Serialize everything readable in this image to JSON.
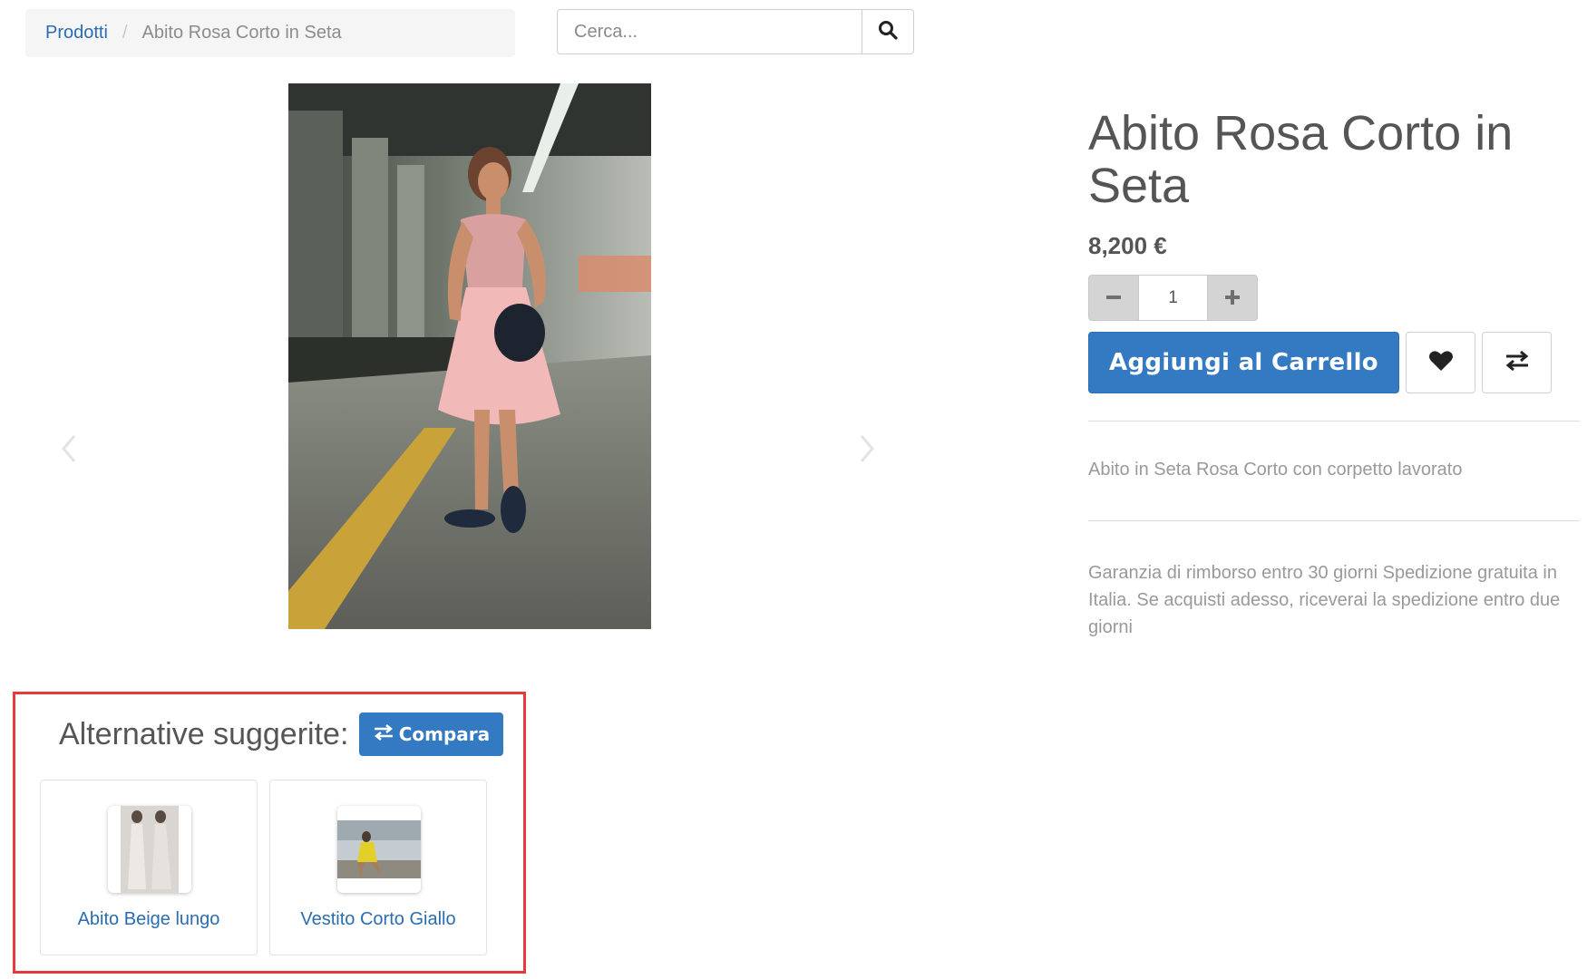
{
  "breadcrumb": {
    "parent": "Prodotti",
    "separator": "/",
    "current": "Abito Rosa Corto in Seta"
  },
  "search": {
    "placeholder": "Cerca...",
    "icon": "search-icon"
  },
  "carousel": {
    "prev_icon": "chevron-left-icon",
    "next_icon": "chevron-right-icon"
  },
  "product": {
    "title": "Abito Rosa Corto in Seta",
    "price": "8,200 €",
    "quantity": "1",
    "add_to_cart_label": "Aggiungi al Carrello",
    "description": "Abito in Seta Rosa Corto con corpetto lavorato",
    "guarantee": "Garanzia di rimborso entro 30 giorni Spedizione gratuita in Italia. Se acquisti adesso, riceverai la spedizione entro due giorni"
  },
  "alternatives": {
    "title": "Alternative suggerite:",
    "compare_label": "Compara",
    "items": [
      {
        "name": "Abito Beige lungo"
      },
      {
        "name": "Vestito Corto Giallo"
      }
    ]
  },
  "colors": {
    "primary": "#347ac2",
    "link": "#2a6cb0",
    "highlight_border": "#e8393f"
  }
}
